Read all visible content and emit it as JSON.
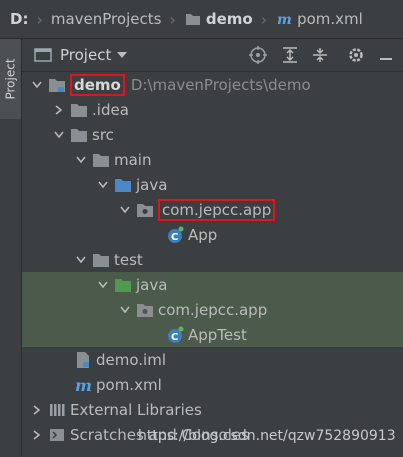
{
  "breadcrumb": {
    "drive": "D:",
    "folder": "mavenProjects",
    "module": "demo",
    "file": "pom.xml"
  },
  "side_panel": {
    "project_tab": "Project"
  },
  "panel_header": {
    "title": "Project"
  },
  "tree": {
    "demo": {
      "label": "demo",
      "path": "D:\\mavenProjects\\demo"
    },
    "idea": "idea",
    "idea_dot": ".",
    "src": "src",
    "main": "main",
    "main_java": "java",
    "main_package": "com.jepcc.app",
    "app": "App",
    "test": "test",
    "test_java": "java",
    "test_package": "com.jepcc.app",
    "apptest": "AppTest",
    "demo_iml": "demo.iml",
    "pom": "pom.xml",
    "external_libraries": "External Libraries",
    "scratches": "Scratches and Consoles"
  },
  "watermark": "https://blog.csdn.net/qzw752890913",
  "colors": {
    "background": "#3c3f41",
    "selected_row": "#4b5a4a",
    "highlight_box": "#e0141e",
    "folder_blue": "#4a88c7",
    "folder_green": "#4e9a4e",
    "folder_gray": "#8a8f94"
  },
  "icons": {
    "breadcrumb_folder": "folder-icon",
    "maven": "maven-icon",
    "locate": "crosshair-icon",
    "expand_all": "expand-all-icon",
    "collapse_all": "collapse-all-icon",
    "settings": "gear-icon",
    "hide": "minimize-icon",
    "class": "class-icon",
    "libraries": "library-icon",
    "scratches": "scratch-icon"
  }
}
